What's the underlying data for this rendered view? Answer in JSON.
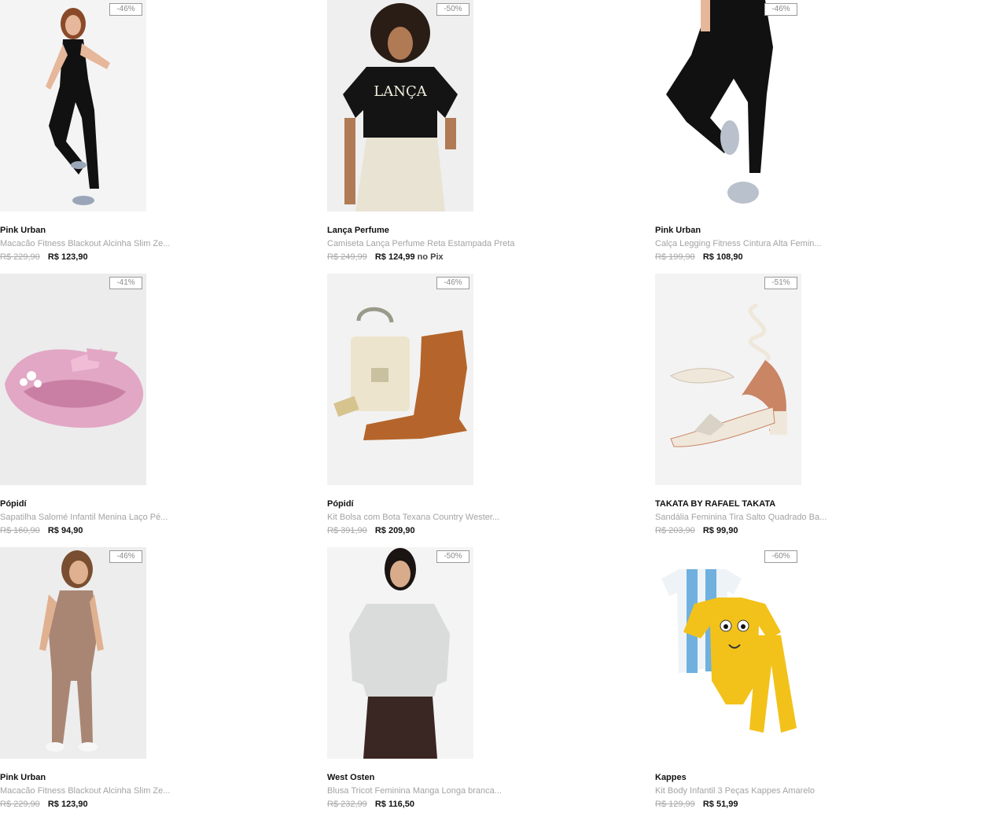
{
  "products": [
    {
      "brand": "Pink Urban",
      "name": "Macacão Fitness Blackout Alcinha Slim Ze...",
      "old_price": "R$ 229,90",
      "price": "R$ 123,90",
      "price_suffix": "",
      "discount": "-46%",
      "image_icon": "woman-black-jumpsuit-image",
      "colors": {
        "bg": "#f4f4f4",
        "main": "#111111"
      }
    },
    {
      "brand": "Lança Perfume",
      "name": "Camiseta Lança Perfume Reta Estampada Preta",
      "old_price": "R$ 249,99",
      "price": "R$ 124,99",
      "price_suffix": "no Pix",
      "discount": "-50%",
      "image_icon": "woman-black-tshirt-image",
      "colors": {
        "bg": "#efefef",
        "main": "#141414"
      }
    },
    {
      "brand": "Pink Urban",
      "name": "Calça Legging Fitness Cintura Alta Femin...",
      "old_price": "R$ 199,90",
      "price": "R$ 108,90",
      "price_suffix": "",
      "discount": "-46%",
      "image_icon": "black-leggings-image",
      "colors": {
        "bg": "#ffffff",
        "main": "#111111"
      }
    },
    {
      "brand": "Pópidí",
      "name": "Sapatilha Salomé Infantil Menina Laço Pé...",
      "old_price": "R$ 160,90",
      "price": "R$ 94,90",
      "price_suffix": "",
      "discount": "-41%",
      "image_icon": "pink-shoe-image",
      "colors": {
        "bg": "#ececec",
        "main": "#e2a7c4"
      }
    },
    {
      "brand": "Pópidí",
      "name": "Kit Bolsa com Bota Texana Country Wester...",
      "old_price": "R$ 391,90",
      "price": "R$ 209,90",
      "price_suffix": "",
      "discount": "-46%",
      "image_icon": "bag-and-boot-image",
      "colors": {
        "bg": "#f2f2f2",
        "main": "#b5652b"
      }
    },
    {
      "brand": "TAKATA BY RAFAEL TAKATA",
      "name": "Sandália Feminina Tira Salto Quadrado Ba...",
      "old_price": "R$ 203,90",
      "price": "R$ 99,90",
      "price_suffix": "",
      "discount": "-51%",
      "image_icon": "sandal-image",
      "colors": {
        "bg": "#f3f3f3",
        "main": "#e9e0d3"
      }
    },
    {
      "brand": "Pink Urban",
      "name": "Macacão Fitness Blackout Alcinha Slim Ze...",
      "old_price": "R$ 229,90",
      "price": "R$ 123,90",
      "price_suffix": "",
      "discount": "-46%",
      "image_icon": "woman-brown-jumpsuit-image",
      "colors": {
        "bg": "#ededed",
        "main": "#a98674"
      }
    },
    {
      "brand": "West Osten",
      "name": "Blusa Tricot Feminina Manga Longa branca...",
      "old_price": "R$ 232,99",
      "price": "R$ 116,50",
      "price_suffix": "",
      "discount": "-50%",
      "image_icon": "woman-knit-sweater-image",
      "colors": {
        "bg": "#f4f4f4",
        "main": "#d9dcda"
      }
    },
    {
      "brand": "Kappes",
      "name": "Kit Body Infantil 3 Peças Kappes Amarelo",
      "old_price": "R$ 129,99",
      "price": "R$ 51,99",
      "price_suffix": "",
      "discount": "-60%",
      "image_icon": "baby-kit-image",
      "colors": {
        "bg": "#ffffff",
        "main": "#f2c21a"
      }
    }
  ]
}
